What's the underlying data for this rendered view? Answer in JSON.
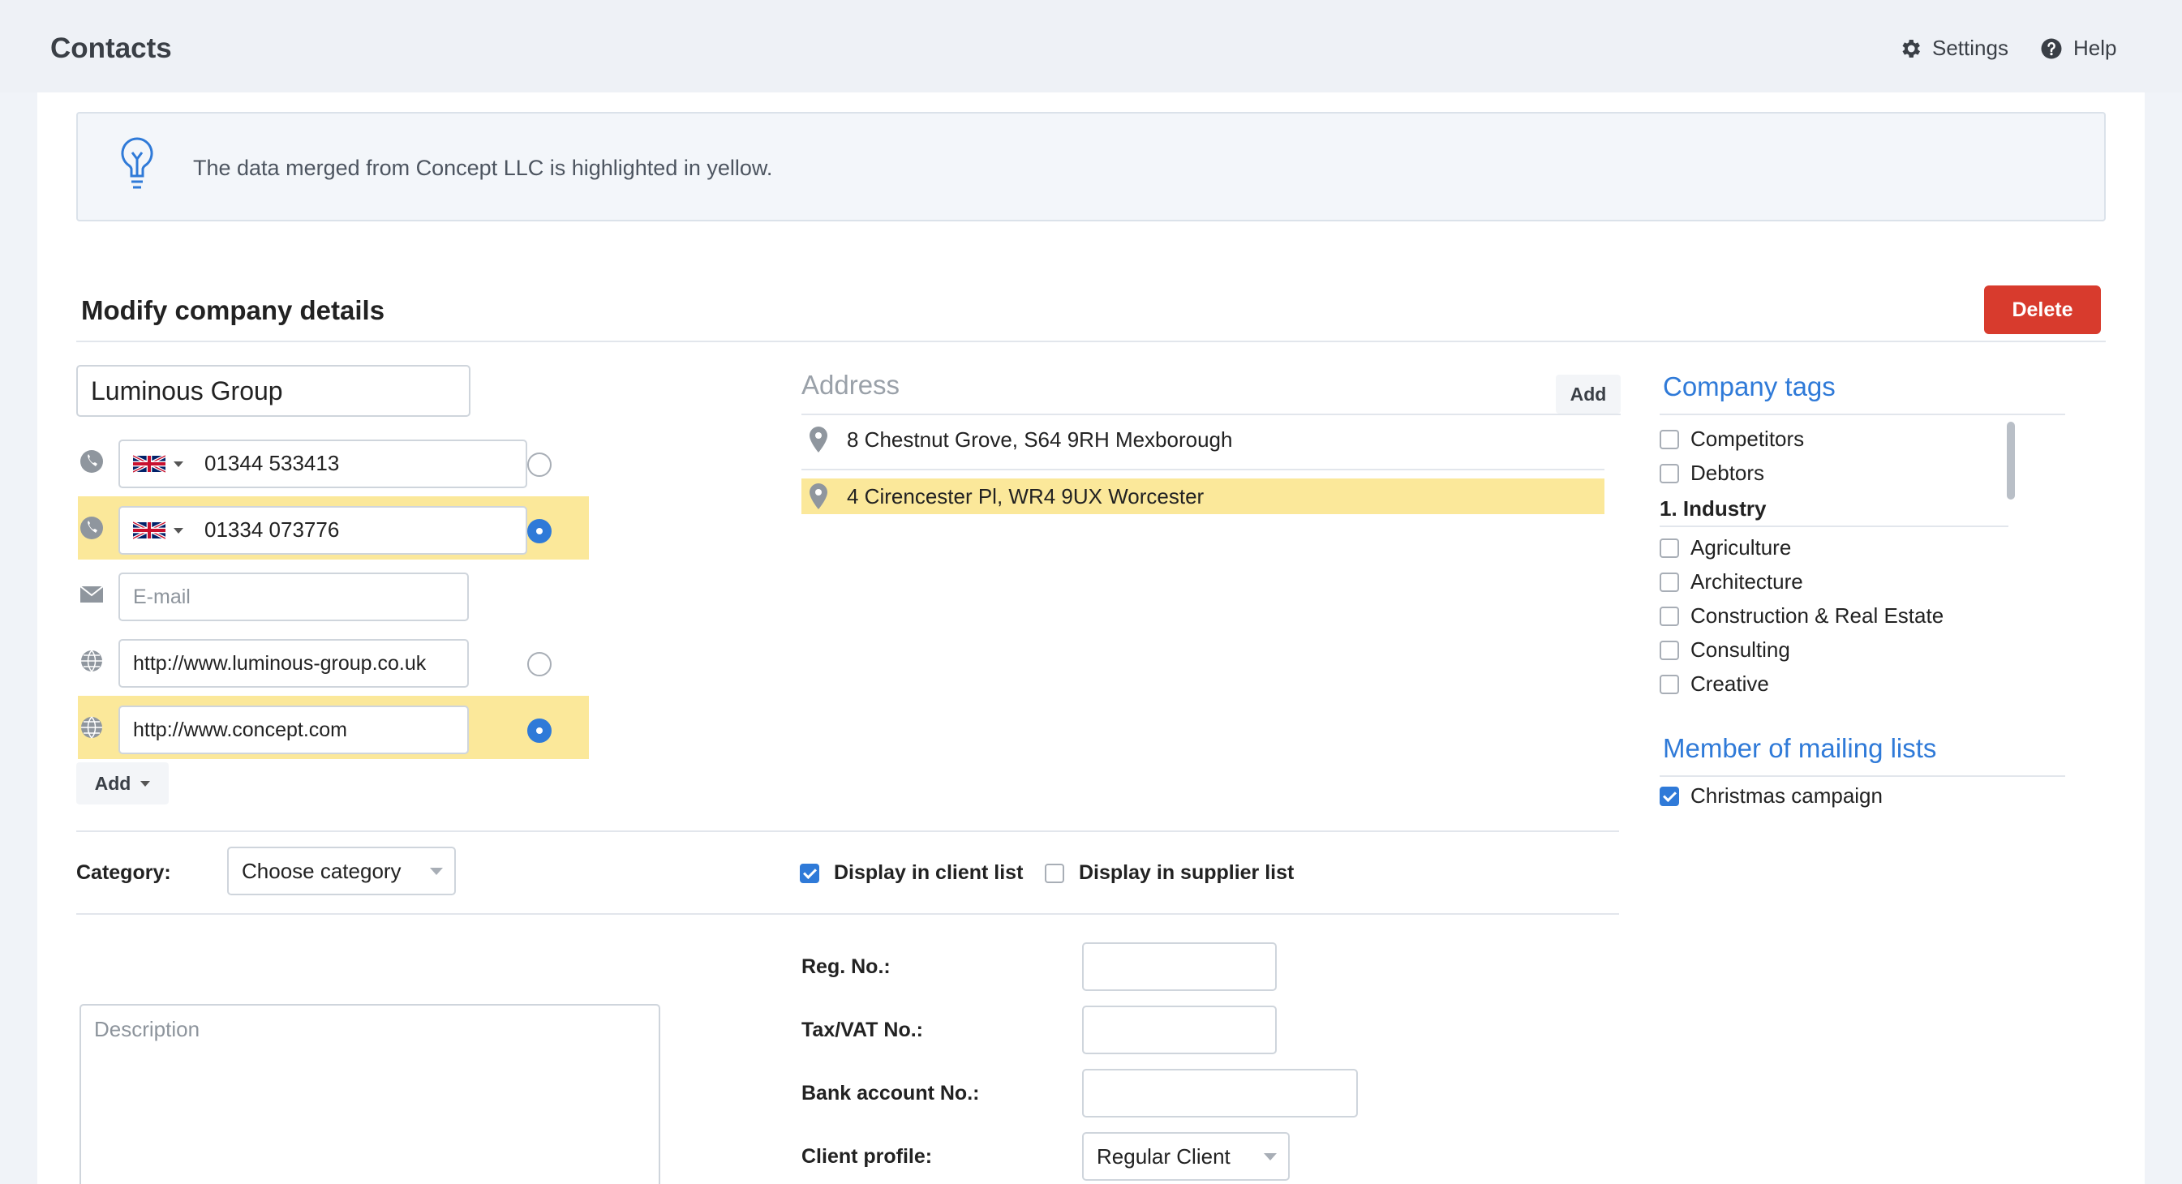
{
  "app": {
    "title": "Contacts",
    "settings_label": "Settings",
    "help_label": "Help"
  },
  "info": {
    "message": "The data merged from Concept LLC is highlighted in yellow."
  },
  "section": {
    "title": "Modify company details",
    "delete_label": "Delete"
  },
  "company": {
    "name": "Luminous Group"
  },
  "phones": [
    {
      "number": "01344 533413",
      "country": "GB",
      "default": false,
      "merged": false
    },
    {
      "number": "01334 073776",
      "country": "GB",
      "default": true,
      "merged": true
    }
  ],
  "email": {
    "placeholder": "E-mail",
    "value": ""
  },
  "websites": [
    {
      "url": "http://www.luminous-group.co.uk",
      "default": false,
      "merged": false
    },
    {
      "url": "http://www.concept.com",
      "default": true,
      "merged": true
    }
  ],
  "add_contact_label": "Add",
  "address": {
    "title": "Address",
    "add_label": "Add",
    "items": [
      {
        "text": "8 Chestnut Grove, S64 9RH Mexborough",
        "merged": false
      },
      {
        "text": "4 Cirencester Pl, WR4 9UX Worcester",
        "merged": true
      }
    ]
  },
  "company_tags": {
    "title": "Company tags",
    "ungrouped": [
      {
        "label": "Competitors",
        "checked": false
      },
      {
        "label": "Debtors",
        "checked": false
      }
    ],
    "group_title": "1. Industry",
    "group_items": [
      {
        "label": "Agriculture",
        "checked": false
      },
      {
        "label": "Architecture",
        "checked": false
      },
      {
        "label": "Construction & Real Estate",
        "checked": false
      },
      {
        "label": "Consulting",
        "checked": false
      },
      {
        "label": "Creative",
        "checked": false
      }
    ]
  },
  "mailing_lists": {
    "title": "Member of mailing lists",
    "items": [
      {
        "label": "Christmas campaign",
        "checked": true
      }
    ]
  },
  "category": {
    "label": "Category:",
    "placeholder": "Choose category"
  },
  "display": {
    "client_label": "Display in client list",
    "client_checked": true,
    "supplier_label": "Display in supplier list",
    "supplier_checked": false
  },
  "description": {
    "placeholder": "Description"
  },
  "fields": {
    "reg_no_label": "Reg. No.:",
    "tax_label": "Tax/VAT No.:",
    "bank_label": "Bank account No.:",
    "client_profile_label": "Client profile:",
    "client_profile_value": "Regular Client"
  },
  "colors": {
    "accent": "#2f7ad8",
    "danger": "#d83b2d",
    "merged_highlight": "#fbe89a"
  }
}
